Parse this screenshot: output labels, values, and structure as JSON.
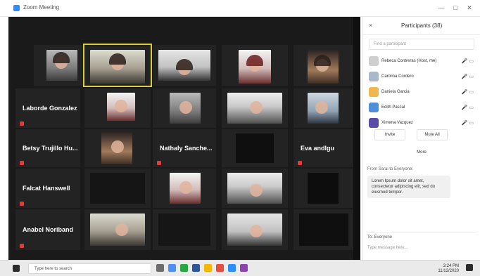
{
  "window": {
    "title": "Zoom Meeting",
    "controls": [
      "—",
      "□",
      "✕"
    ]
  },
  "video": {
    "tiles": [
      {
        "id": "t1",
        "kind": "photo",
        "name": "",
        "label": ""
      },
      {
        "id": "t2",
        "kind": "photo",
        "name": "",
        "label": "",
        "active": true
      },
      {
        "id": "t3",
        "kind": "photo",
        "name": "",
        "label": ""
      },
      {
        "id": "t4",
        "kind": "photo",
        "name": "",
        "label": ""
      },
      {
        "id": "t5",
        "kind": "photo",
        "name": "",
        "label": ""
      },
      {
        "id": "t6",
        "kind": "text",
        "name": "",
        "label": "Laborde Gonzalez",
        "muted": true
      },
      {
        "id": "t7",
        "kind": "photo",
        "name": "",
        "label": ""
      },
      {
        "id": "t8",
        "kind": "photo",
        "name": "",
        "label": ""
      },
      {
        "id": "t9",
        "kind": "photo",
        "name": "",
        "label": ""
      },
      {
        "id": "t10",
        "kind": "photo",
        "name": "",
        "label": ""
      },
      {
        "id": "t11",
        "kind": "text",
        "name": "",
        "label": "Betsy Trujillo Hu...",
        "muted": true
      },
      {
        "id": "t12",
        "kind": "photo",
        "name": "",
        "label": ""
      },
      {
        "id": "t13",
        "kind": "text",
        "name": "",
        "label": "Nathaly Sanche...",
        "muted": true
      },
      {
        "id": "t14",
        "kind": "photo",
        "name": "",
        "label": ""
      },
      {
        "id": "t15",
        "kind": "text",
        "name": "",
        "label": "Eva andlgu",
        "muted": true
      },
      {
        "id": "t16",
        "kind": "text",
        "name": "",
        "label": "Falcat Hanswell",
        "muted": true
      },
      {
        "id": "t17",
        "kind": "photo",
        "name": "",
        "label": ""
      },
      {
        "id": "t18",
        "kind": "photo",
        "name": "",
        "label": ""
      },
      {
        "id": "t19",
        "kind": "photo",
        "name": "",
        "label": ""
      },
      {
        "id": "t20",
        "kind": "photo",
        "name": "",
        "label": ""
      },
      {
        "id": "t21",
        "kind": "text",
        "name": "",
        "label": "Anabel Noriband",
        "muted": true
      },
      {
        "id": "t22",
        "kind": "photo",
        "name": "",
        "label": ""
      },
      {
        "id": "t23",
        "kind": "photo",
        "name": "",
        "label": ""
      },
      {
        "id": "t24",
        "kind": "photo",
        "name": "",
        "label": ""
      },
      {
        "id": "t25",
        "kind": "photo",
        "name": "",
        "label": ""
      }
    ]
  },
  "panel": {
    "title": "Participants (38)",
    "close": "×",
    "search_placeholder": "Find a participant",
    "participants": [
      {
        "name": "Rebeca Contreras (Host, me)",
        "icons": "🎤 ▭"
      },
      {
        "name": "Carolina Cordero",
        "icons": "🎤 ▭"
      },
      {
        "name": "Daniela Garcia",
        "icons": "🎤 ▭"
      },
      {
        "name": "Edith Pascal",
        "icons": "🎤 ▭"
      },
      {
        "name": "Ximena Vazquez",
        "icons": "🎤 ▭"
      }
    ],
    "buttons": {
      "invite": "Invite",
      "mute_all": "Mute All",
      "more": "More"
    },
    "chat": {
      "label": "From Sarai to Everyone:",
      "message": "Lorem Ipsum dolor sit amet, consectetur adipiscing elit, sed do eiusmod tempor."
    },
    "send_to": "To: Everyone",
    "typing_placeholder": "Type message here..."
  },
  "taskbar": {
    "search_placeholder": "Type here to search",
    "time": "3:24 PM",
    "date": "11/12/2020"
  }
}
